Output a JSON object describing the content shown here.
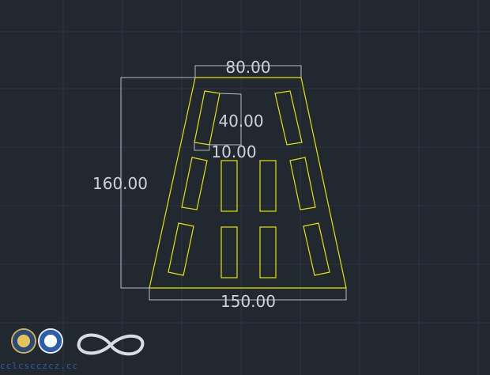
{
  "viewport": {
    "name": "CAD drawing viewport",
    "background_color": "#212830",
    "grid_color": "#2c3440",
    "geometry_color": "#e5e500",
    "dimension_color": "#b8bcc2"
  },
  "dimensions": {
    "top_width": "80.00",
    "bottom_width": "150.00",
    "height": "160.00",
    "slot_length": "40.00",
    "slot_width": "10.00"
  },
  "watermark": {
    "logos": [
      "university-seal-icon",
      "institute-seal-icon",
      "infinity-link-icon"
    ],
    "caption": "cclcscczcz.cc"
  }
}
